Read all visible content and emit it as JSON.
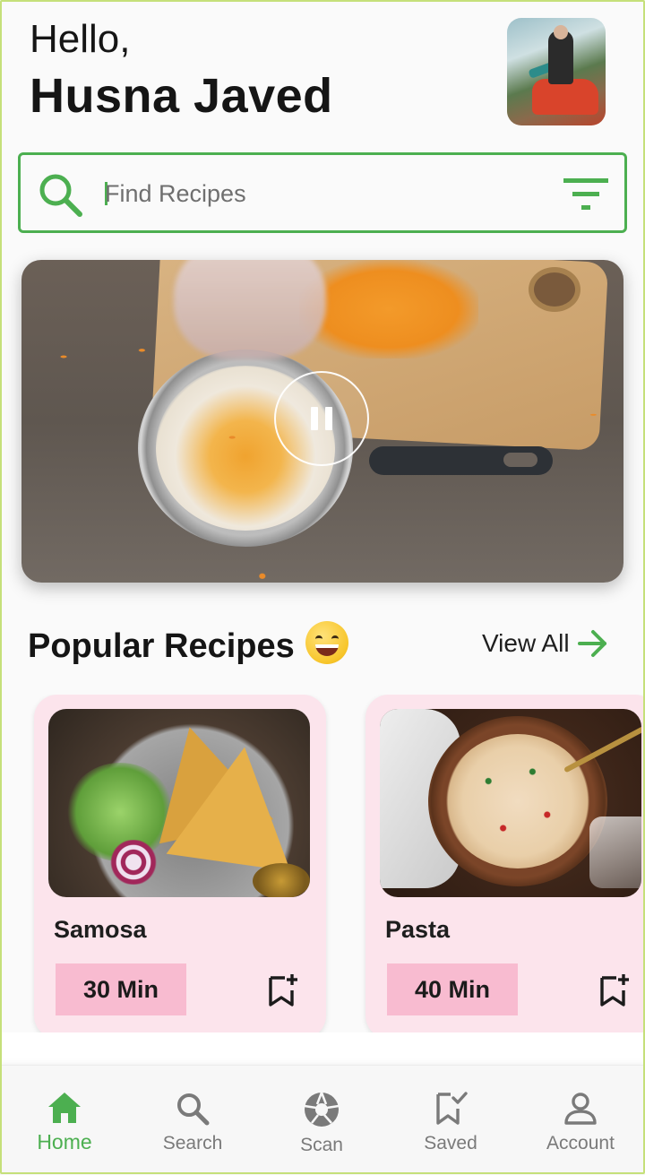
{
  "header": {
    "greeting": "Hello,",
    "user_name": "Husna Javed",
    "avatar_icon": "profile-photo"
  },
  "search": {
    "placeholder": "Find Recipes",
    "value": "",
    "search_icon": "search-icon",
    "filter_icon": "filter-icon"
  },
  "video": {
    "state": "playing",
    "control_icon": "pause-icon"
  },
  "popular": {
    "title": "Popular Recipes",
    "emoji": "😄",
    "view_all_label": "View All",
    "view_all_icon": "arrow-right-icon",
    "recipes": [
      {
        "name": "Samosa",
        "time": "30 Min",
        "bookmark_icon": "bookmark-add-icon"
      },
      {
        "name": "Pasta",
        "time": "40 Min",
        "bookmark_icon": "bookmark-add-icon"
      }
    ]
  },
  "bottom_nav": {
    "active": "Home",
    "items": [
      {
        "label": "Home",
        "icon": "home-icon"
      },
      {
        "label": "Search",
        "icon": "search-icon"
      },
      {
        "label": "Scan",
        "icon": "camera-shutter-icon"
      },
      {
        "label": "Saved",
        "icon": "bookmark-check-icon"
      },
      {
        "label": "Account",
        "icon": "person-icon"
      }
    ]
  },
  "colors": {
    "accent": "#4caf50",
    "card_background": "#fce4ec",
    "time_badge": "#f8bbd0",
    "frame_border": "#c5e07a"
  }
}
